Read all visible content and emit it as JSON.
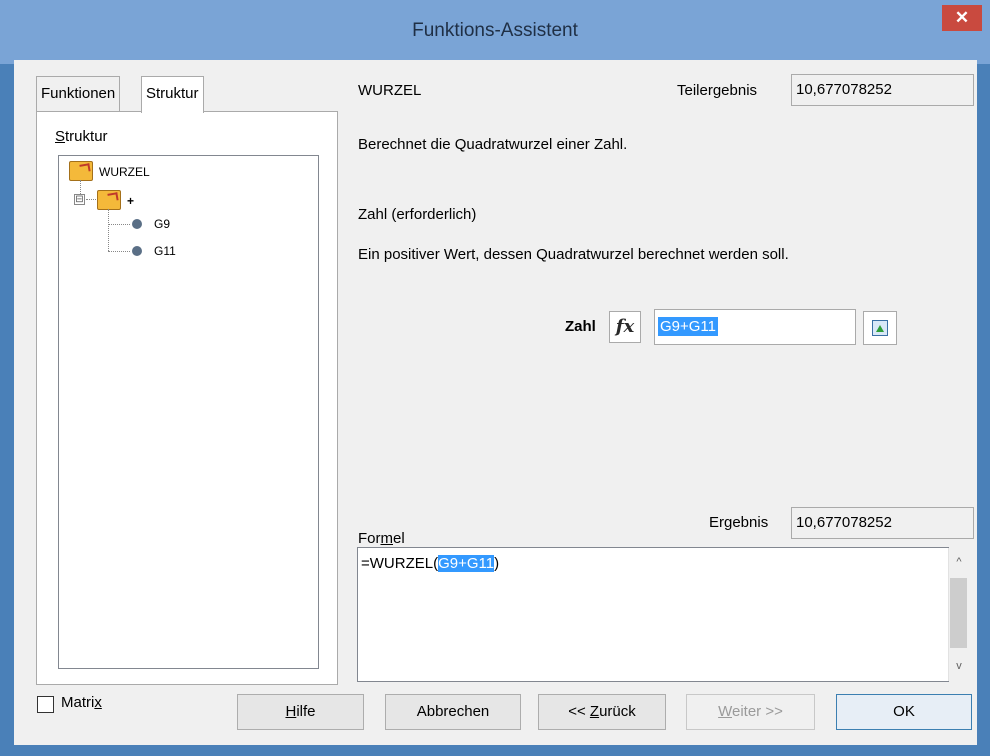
{
  "window": {
    "title": "Funktions-Assistent",
    "close_glyph": "✕"
  },
  "tabs": [
    {
      "label": "Funktionen"
    },
    {
      "label": "Struktur"
    }
  ],
  "structure": {
    "label_ul": "S",
    "label_rest": "truktur",
    "tree": [
      {
        "label": "WURZEL"
      },
      {
        "label": "+"
      },
      {
        "label": "G9"
      },
      {
        "label": "G11"
      }
    ],
    "expander": "⊟"
  },
  "function": {
    "name": "WURZEL",
    "partial_label": "Teilergebnis",
    "partial_value": "10,677078252",
    "description": "Berechnet die Quadratwurzel einer Zahl.",
    "arg_name": "Zahl (erforderlich)",
    "arg_desc": "Ein positiver Wert, dessen Quadratwurzel berechnet werden soll.",
    "arg_label": "Zahl",
    "arg_value": "G9+G11",
    "fx_glyph": "fx"
  },
  "formula": {
    "label_pre": "For",
    "label_ul": "m",
    "label_post": "el",
    "result_label": "Ergebnis",
    "result_value": "10,677078252",
    "text_pre": "=WURZEL(",
    "text_sel": "G9+G11",
    "text_post": ")",
    "scroll_up": "^",
    "scroll_down": "v"
  },
  "matrix": {
    "label_pre": "Matri",
    "label_ul": "x"
  },
  "buttons": {
    "help": {
      "ul": "H",
      "rest": "ilfe"
    },
    "cancel": "Abbrechen",
    "back": {
      "pre": "<< ",
      "ul": "Z",
      "rest": "urück"
    },
    "next": {
      "ul": "W",
      "rest": "eiter >>"
    },
    "ok": "OK"
  },
  "colors": {
    "titlebar": "#7aa4d6",
    "close": "#c94a3f",
    "selection": "#3399ff"
  }
}
